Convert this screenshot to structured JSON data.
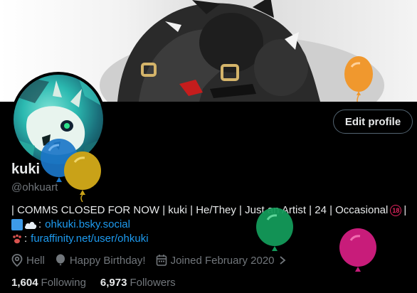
{
  "profile": {
    "name": "kuki",
    "handle": "@ohkuart",
    "edit_label": "Edit profile",
    "bio": {
      "line1_text": "| COMMS CLOSED FOR NOW | kuki | He/They | Just an Artist | 24 | Occasional",
      "line1_badge": "18",
      "line1_end": "|",
      "line2_prefix": ":",
      "line2_link": "ohkuki.bsky.social",
      "line3_prefix": ":",
      "line3_link": "furaffinity.net/user/ohkuki"
    },
    "meta": {
      "location": "Hell",
      "birthday": "Happy Birthday!",
      "joined": "Joined February 2020"
    },
    "stats": {
      "following_count": "1,604",
      "following_label": "Following",
      "followers_count": "6,973",
      "followers_label": "Followers"
    }
  },
  "icons": [
    "location-pin-icon",
    "balloon-icon",
    "calendar-icon",
    "chevron-right-icon"
  ],
  "colors": {
    "link": "#1d9bf0",
    "secondary_text": "#71767b",
    "balloon_orange": "#f0982e",
    "balloon_blue": "#1b76c8",
    "balloon_gold": "#c9a218",
    "balloon_green": "#139a5a",
    "balloon_magenta": "#c81c7a"
  }
}
